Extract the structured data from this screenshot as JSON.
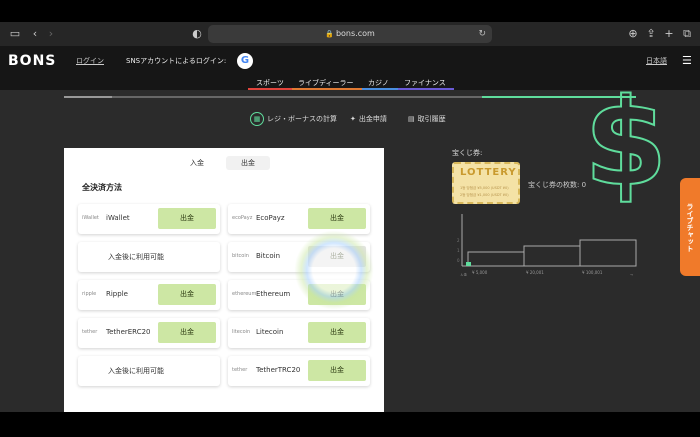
{
  "browser": {
    "url": "bons.com"
  },
  "header": {
    "logo": "BONS",
    "login_link": "ログイン",
    "sns_label": "SNSアカウントによるログイン:",
    "google_letter": "G",
    "language": "日本語"
  },
  "nav": {
    "items": [
      {
        "label": "スポーツ",
        "color": "#e0443c"
      },
      {
        "label": "ライブディーラー",
        "color": "#e07a33"
      },
      {
        "label": "カジノ",
        "color": "#4a8ee0"
      },
      {
        "label": "ファイナンス",
        "color": "#6a5ad6"
      }
    ]
  },
  "subnav": {
    "items": [
      {
        "label": "レジ・ボーナスの計算",
        "icon": "calculator-icon"
      },
      {
        "label": "出金申請",
        "icon": "handshake-icon"
      },
      {
        "label": "取引履歴",
        "icon": "receipt-icon"
      }
    ]
  },
  "panel": {
    "tabs": {
      "deposit": "入金",
      "withdraw": "出金"
    },
    "title": "全決済方法",
    "methods": [
      {
        "logo": "iWallet",
        "name": "iWallet",
        "button": "出金"
      },
      {
        "logo": "ecoPayz",
        "name": "EcoPayz",
        "button": "出金"
      },
      {
        "logo": "",
        "name": "入金後に利用可能",
        "button": ""
      },
      {
        "logo": "bitcoin",
        "name": "Bitcoin",
        "button": "出金"
      },
      {
        "logo": "ripple",
        "name": "Ripple",
        "button": "出金"
      },
      {
        "logo": "ethereum",
        "name": "Ethereum",
        "button": "出金"
      },
      {
        "logo": "tether",
        "name": "TetherERC20",
        "button": "出金"
      },
      {
        "logo": "litecoin",
        "name": "Litecoin",
        "button": "出金"
      },
      {
        "logo": "",
        "name": "入金後に利用可能",
        "button": ""
      },
      {
        "logo": "tether",
        "name": "TetherTRC20",
        "button": "出金"
      }
    ]
  },
  "lottery": {
    "label": "宝くじ券:",
    "ticket_title": "LOTTERY",
    "ticket_lines": [
      "1등 당첨금 ¥5,000 (USDT ¥0)",
      "2등 당첨금 ¥1,000 (USDT ¥0)"
    ],
    "count_label": "宝くじ券の枚数: 0",
    "tiers": [
      {
        "label": "¥ 5,000"
      },
      {
        "label": "¥ 20,001"
      },
      {
        "label": "¥ 100,001"
      }
    ],
    "axis_start": "入金",
    "axis_end": "→",
    "y_ticks": [
      "2",
      "1",
      "0"
    ]
  },
  "livechat": {
    "label": "ライブチャット"
  },
  "colors": {
    "accent_green": "#5fdc9c",
    "button_green": "#cde7a4",
    "livechat_orange": "#f07a2a"
  }
}
